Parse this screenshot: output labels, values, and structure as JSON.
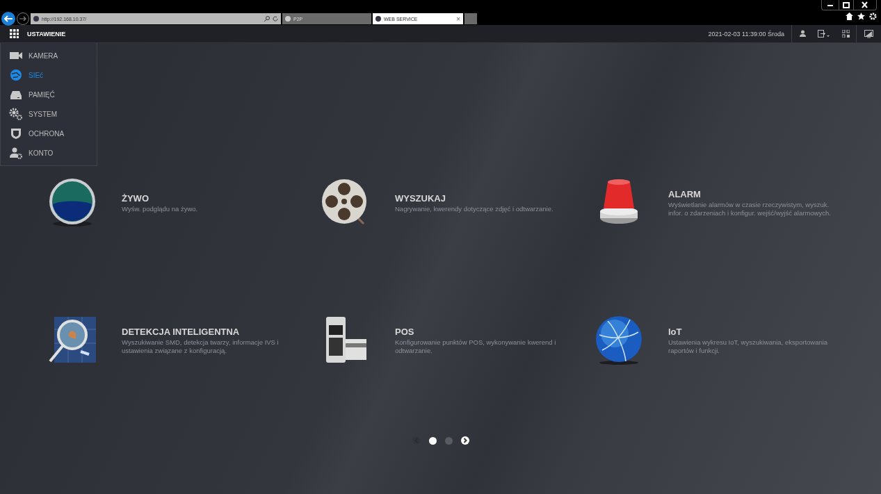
{
  "browser": {
    "address": "http://192.168.10.37/",
    "tabs": [
      {
        "label": "P2P",
        "selected": false
      },
      {
        "label": "WEB SERVICE",
        "selected": true,
        "close": "×"
      }
    ]
  },
  "app_bar": {
    "title": "USTAWIENIE",
    "datetime": "2021-02-03 11:39:00 Środa"
  },
  "menu": [
    {
      "label": "KAMERA",
      "kind": "camera",
      "selected": false
    },
    {
      "label": "SIEć",
      "kind": "network",
      "selected": true
    },
    {
      "label": "PAMIĘĆ",
      "kind": "storage",
      "selected": false
    },
    {
      "label": "SYSTEM",
      "kind": "system",
      "selected": false
    },
    {
      "label": "OCHRONA",
      "kind": "shield",
      "selected": false
    },
    {
      "label": "KONTO",
      "kind": "account",
      "selected": false
    }
  ],
  "tiles": [
    {
      "kind": "live",
      "title": "ŻYWO",
      "description": "Wyśw. podglądu na żywo."
    },
    {
      "kind": "search",
      "title": "WYSZUKAJ",
      "description": "Nagrywanie, kwerendy dotyczące zdjęć i odtwarzanie."
    },
    {
      "kind": "alarm",
      "title": "ALARM",
      "description": "Wyświetlanie alarmów w czasie rzeczywistym, wyszuk. infor. o zdarzeniach i konfigur. wejść/wyjść alarmowych."
    },
    {
      "kind": "smart",
      "title": "DETEKCJA INTELIGENTNA",
      "description": "Wyszukiwanie SMD, detekcja twarzy, informacje IVS i ustawienia związane z konfiguracją."
    },
    {
      "kind": "pos",
      "title": "POS",
      "description": "Konfigurowanie punktów POS, wykonywanie kwerend i odtwarzanie."
    },
    {
      "kind": "iot",
      "title": "IoT",
      "description": "Ustawienia wykresu IoT, wyszukiwania, eksportowania raportów i funkcji."
    }
  ],
  "pager": {
    "prev_disabled": true,
    "pages": [
      {
        "selected": true
      },
      {
        "selected": false
      }
    ]
  }
}
